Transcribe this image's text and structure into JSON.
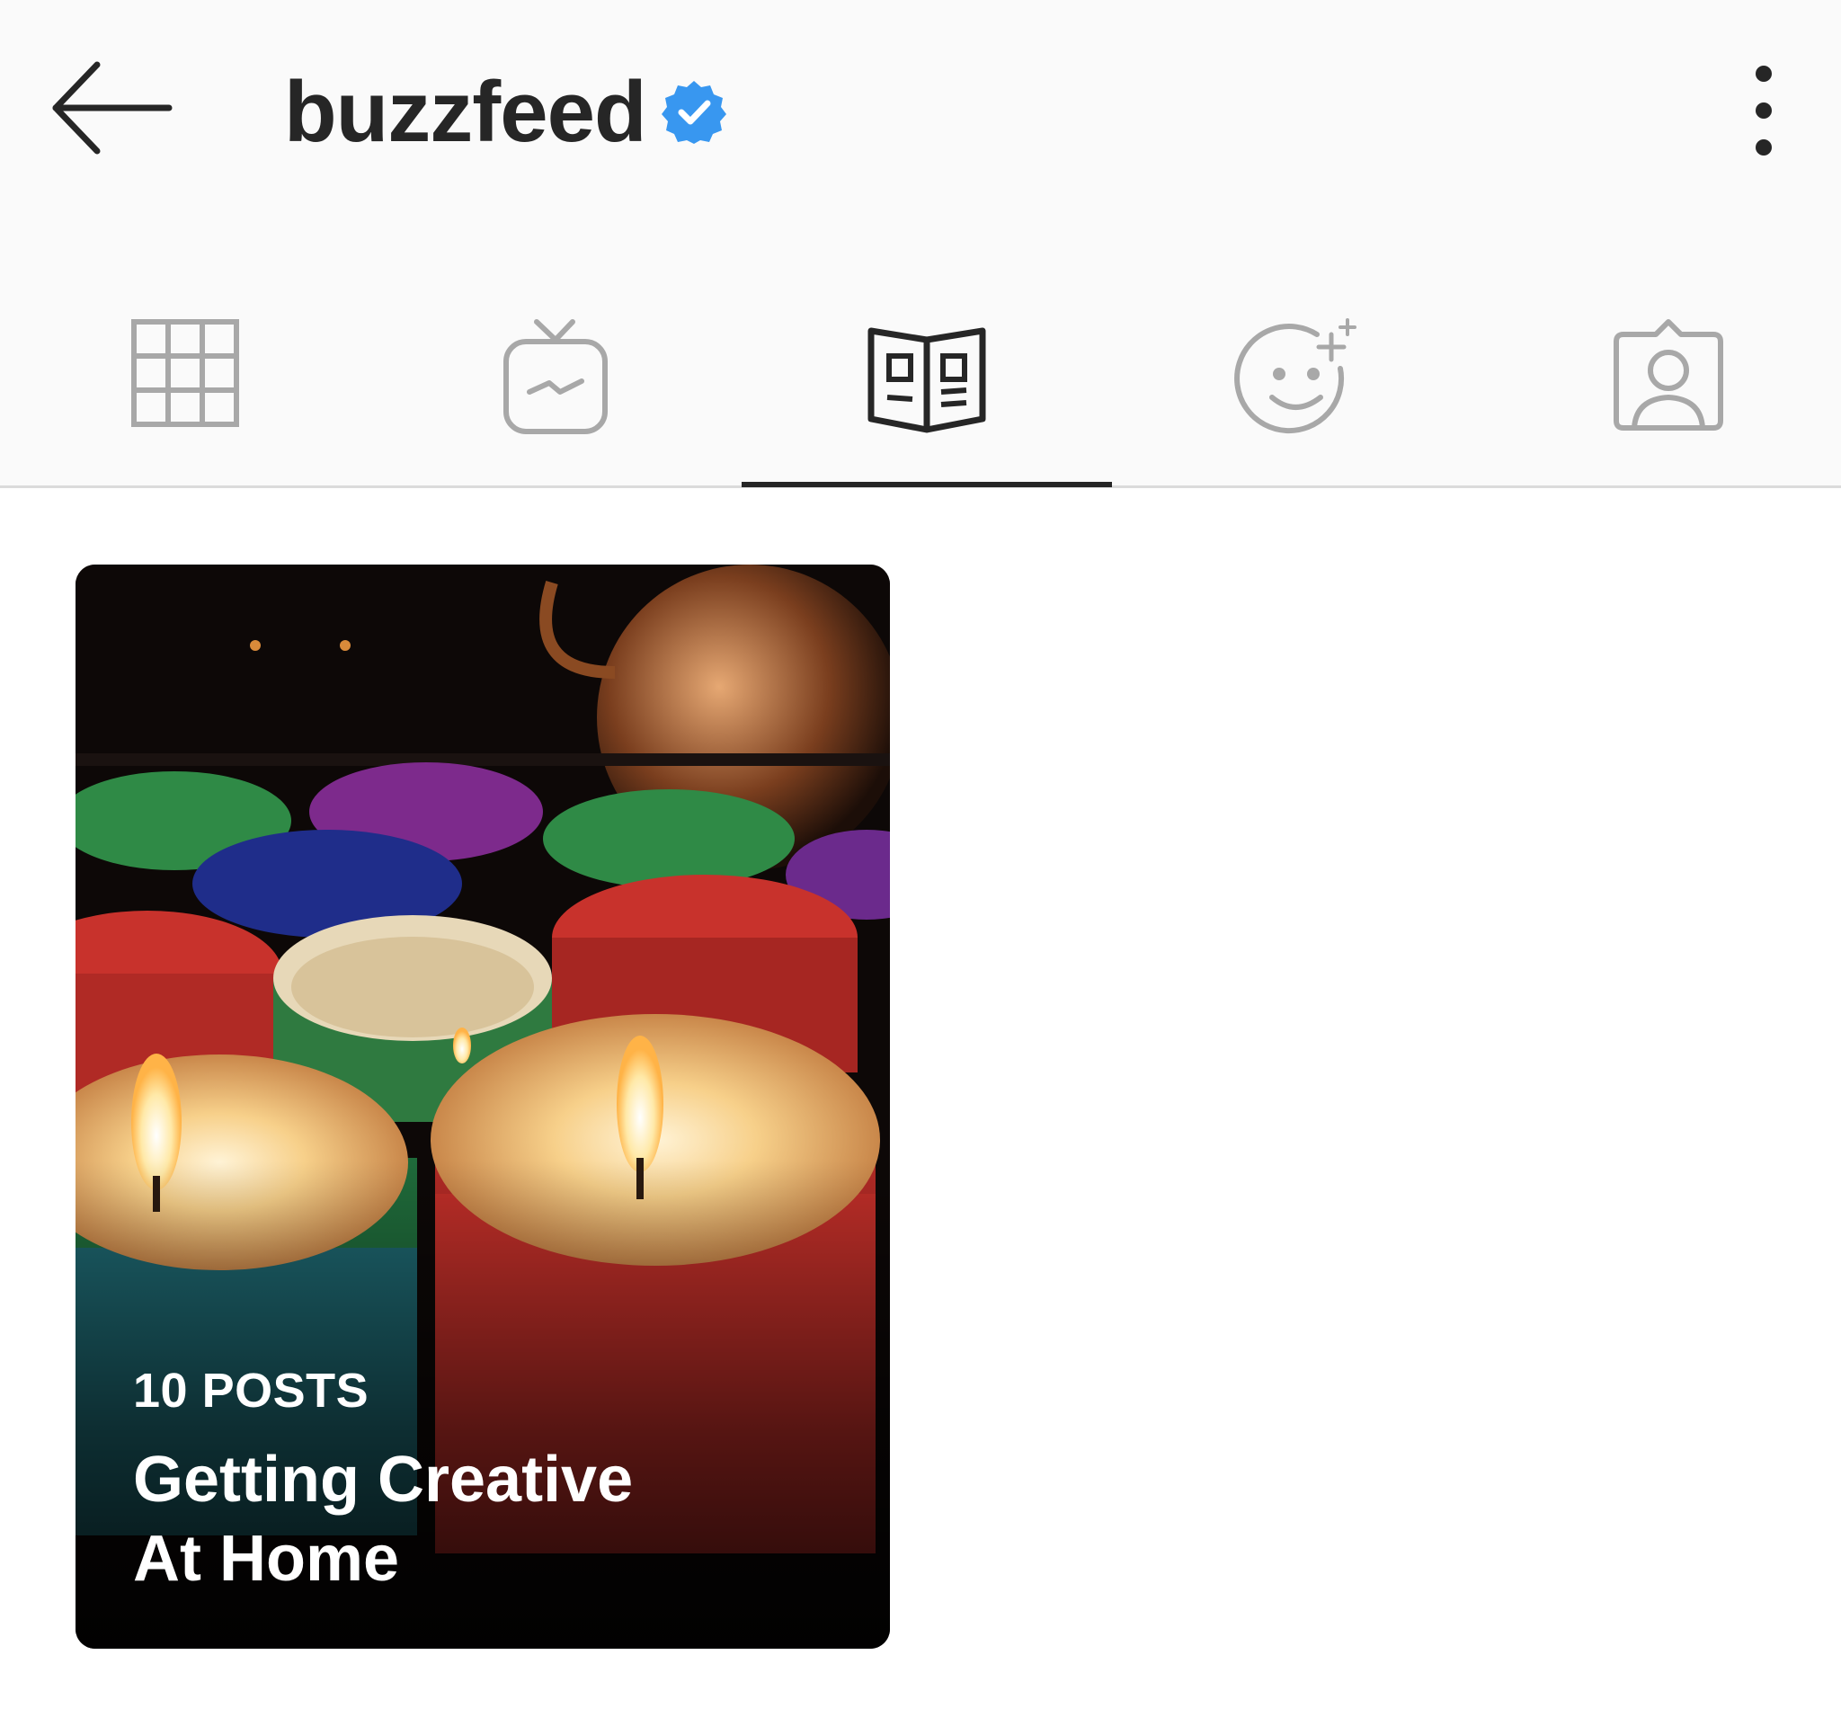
{
  "header": {
    "username": "buzzfeed",
    "back_icon": "arrow-left-icon",
    "verified_icon": "verified-badge-icon",
    "verified_color": "#3897f0",
    "more_icon": "more-vertical-icon"
  },
  "tabs": [
    {
      "name": "posts",
      "icon": "grid-icon",
      "active": false
    },
    {
      "name": "igtv",
      "icon": "igtv-icon",
      "active": false
    },
    {
      "name": "guides",
      "icon": "guide-book-icon",
      "active": true
    },
    {
      "name": "effects",
      "icon": "effects-face-icon",
      "active": false
    },
    {
      "name": "tagged",
      "icon": "tagged-person-icon",
      "active": false
    }
  ],
  "guides": [
    {
      "count_label": "10 POSTS",
      "title_line1": "Getting Creative",
      "title_line2": "At Home",
      "image": "lit-candles-photo"
    }
  ]
}
